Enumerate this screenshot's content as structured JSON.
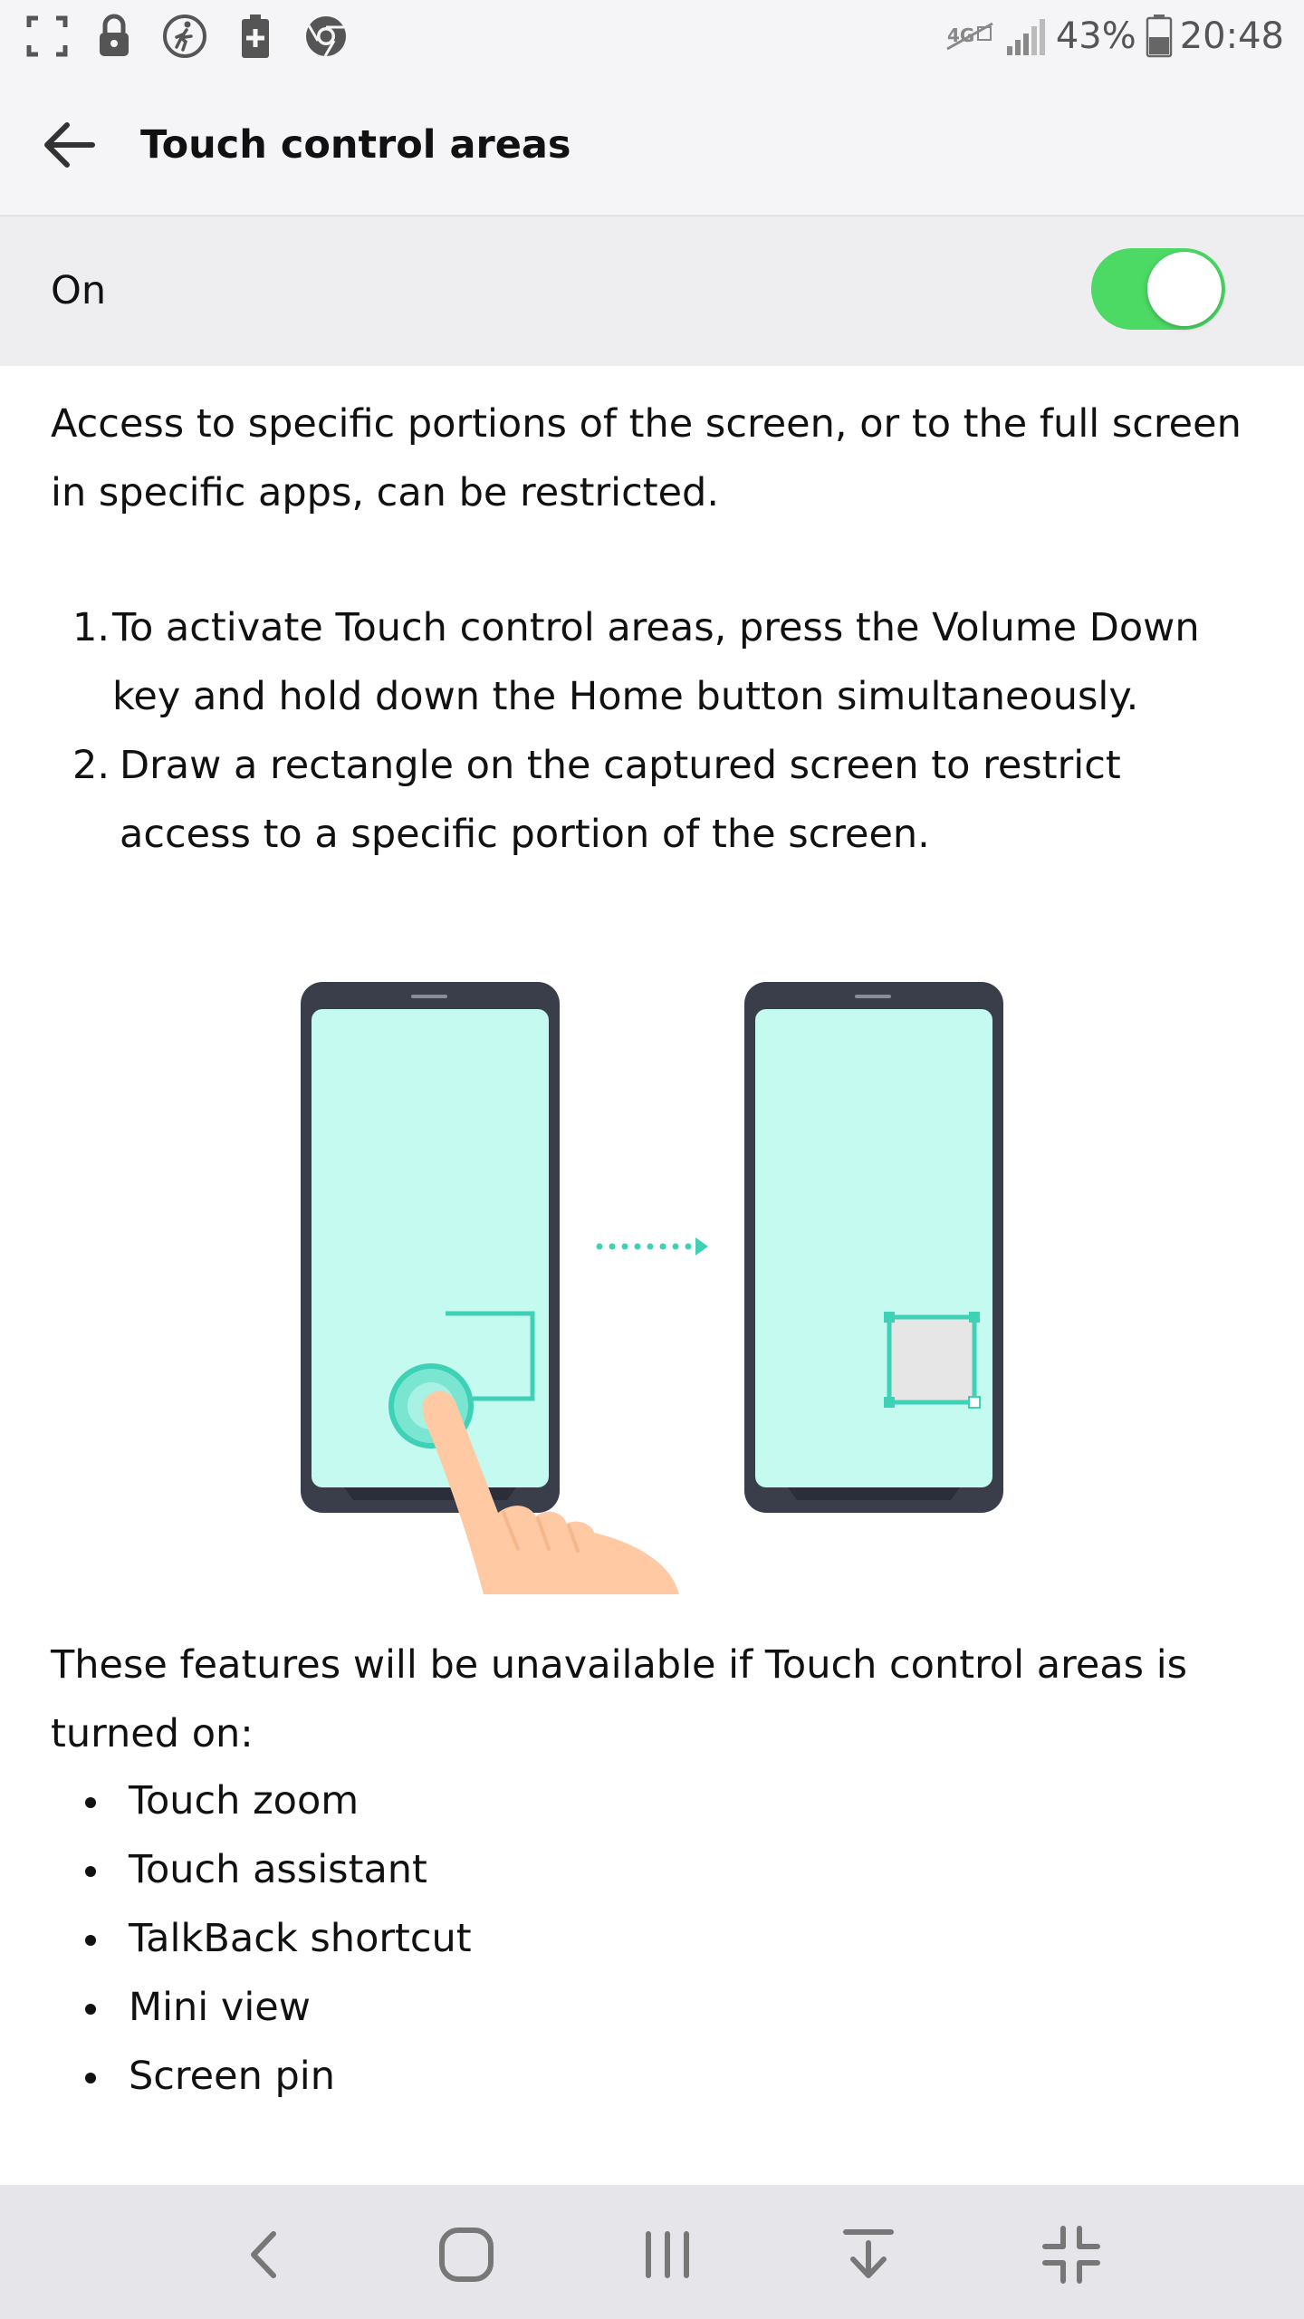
{
  "status_bar": {
    "left_icons": [
      "screenshot-frame-icon",
      "lock-icon",
      "walking-icon",
      "battery-plus-icon",
      "chrome-icon"
    ],
    "right_icons": [
      "wifi-calling-icon",
      "signal-icon",
      "battery-icon"
    ],
    "battery_percent": "43%",
    "time": "20:48"
  },
  "app_bar": {
    "title": "Touch control areas"
  },
  "toggle": {
    "label": "On",
    "state": "on",
    "accent_color": "#4cd964"
  },
  "description": "Access to specific portions of the screen, or to the full screen in specific apps, can be restricted.",
  "steps": [
    {
      "num": "1.",
      "text": "To activate Touch control areas, press the Volume Down key and hold down the Home button simultaneously."
    },
    {
      "num": "2.",
      "text": "Draw a rectangle on the captured screen to restrict access to a specific portion of the screen."
    }
  ],
  "illustration": {
    "icons": [
      "phone-drawing-icon",
      "dotted-arrow-icon",
      "phone-restricted-area-icon",
      "finger-icon"
    ],
    "screen_color": "#c4faf0",
    "accent_color": "#3fd1b5"
  },
  "features_intro": "These features will be unavailable if Touch control areas is turned on:",
  "features": [
    "Touch zoom",
    "Touch assistant",
    "TalkBack shortcut",
    "Mini view",
    "Screen pin"
  ],
  "nav_bar": {
    "buttons": [
      "back-icon",
      "home-icon",
      "recents-icon",
      "notification-pulldown-icon",
      "minimize-icon"
    ]
  }
}
